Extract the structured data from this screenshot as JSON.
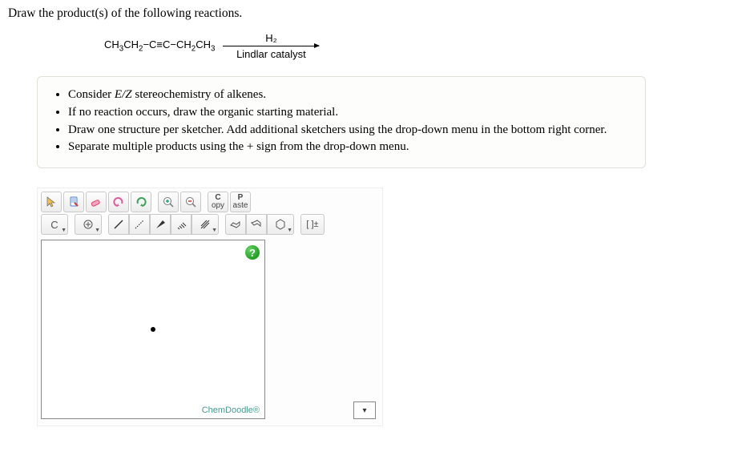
{
  "prompt": "Draw the product(s) of the following reactions.",
  "reaction": {
    "reactant_html": "CH<sub>3</sub>CH<sub>2</sub>−C≡C−CH<sub>2</sub>CH<sub>3</sub>",
    "reagent_top": "H₂",
    "reagent_bottom": "Lindlar catalyst"
  },
  "hints": [
    "Consider <span class='em'>E/Z</span> stereochemistry of alkenes.",
    "If no reaction occurs, draw the organic starting material.",
    "Draw one structure per sketcher. Add additional sketchers using the drop-down menu in the bottom right corner.",
    "Separate multiple products using the + sign from the drop-down menu."
  ],
  "toolbar1": {
    "move": "move-tool",
    "clear": "clear-tool",
    "erase": "erase-tool",
    "undo": "undo-tool",
    "redo": "redo-tool",
    "zoom_in": "zoom-in-tool",
    "zoom_out": "zoom-out-tool",
    "copy_top": "C",
    "copy_bottom": "opy",
    "paste_top": "P",
    "paste_bottom": "aste"
  },
  "toolbar2": {
    "element": "C",
    "charge": "⊕",
    "single": "single-bond",
    "recessed": "recessed-bond",
    "wedge": "wedge-bond",
    "double": "double-bond",
    "triple": "triple-bond",
    "chair1": "chair1",
    "chair2": "chair2",
    "ring": "ring",
    "bracket": "[ ]±"
  },
  "canvas": {
    "help": "?",
    "brand": "ChemDoodle®"
  },
  "addmenu": {
    "selected": ""
  }
}
